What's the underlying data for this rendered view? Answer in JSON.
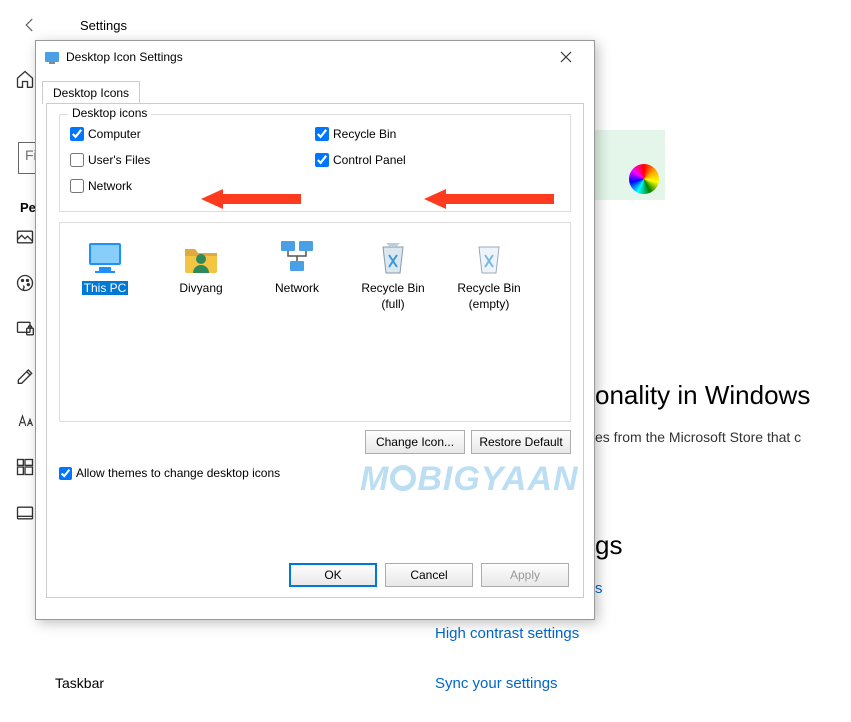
{
  "settings": {
    "title": "Settings",
    "search_placeholder": "Fin",
    "section": "Perso",
    "taskbar": "Taskbar"
  },
  "main": {
    "heading_fragment": "onality in Windows",
    "sub_fragment": "es from the Microsoft Store that c",
    "gs_fragment": "gs",
    "link_s": "s",
    "link_high_contrast": "High contrast settings",
    "link_sync": "Sync your settings"
  },
  "dialog": {
    "title": "Desktop Icon Settings",
    "tab_label": "Desktop Icons",
    "groupbox_title": "Desktop icons",
    "checks": {
      "computer": {
        "label": "Computer",
        "checked": true
      },
      "recycle_bin": {
        "label": "Recycle Bin",
        "checked": true
      },
      "users_files": {
        "label": "User's Files",
        "checked": false
      },
      "control_panel": {
        "label": "Control Panel",
        "checked": true
      },
      "network": {
        "label": "Network",
        "checked": false
      }
    },
    "icons_list": [
      {
        "label": "This PC",
        "sub": ""
      },
      {
        "label": "Divyang",
        "sub": ""
      },
      {
        "label": "Network",
        "sub": ""
      },
      {
        "label": "Recycle Bin",
        "sub": "(full)"
      },
      {
        "label": "Recycle Bin",
        "sub": "(empty)"
      }
    ],
    "change_icon_label": "Change Icon...",
    "restore_default_label": "Restore Default",
    "allow_themes_label": "Allow themes to change desktop icons",
    "allow_themes_checked": true,
    "ok_label": "OK",
    "cancel_label": "Cancel",
    "apply_label": "Apply"
  },
  "watermark": "M  BIGYAAN"
}
